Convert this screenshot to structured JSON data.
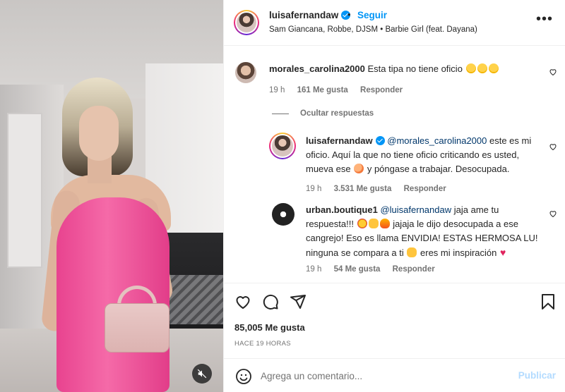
{
  "post": {
    "username": "luisafernandaw",
    "follow_label": "Seguir",
    "audio": "Sam Giancana, Robbe, DJSM • Barbie Girl (feat. Dayana)",
    "more_label": "•••"
  },
  "comments": [
    {
      "username": "morales_carolina2000",
      "text": "Esta tipa no tiene oficio",
      "emojis": [
        "laugh",
        "laugh",
        "laugh"
      ],
      "time": "19 h",
      "likes": "161 Me gusta",
      "reply_label": "Responder"
    }
  ],
  "hide_replies_label": "Ocultar respuestas",
  "replies": [
    {
      "username": "luisafernandaw",
      "mention": "@morales_carolina2000",
      "text_1": "este es mi oficio. Aquí la que no tiene oficio criticando es usted, mueva ese",
      "text_2": "y póngase a trabajar. Desocupada.",
      "time": "19 h",
      "likes": "3.531 Me gusta",
      "reply_label": "Responder"
    },
    {
      "username": "urban.boutique1",
      "mention": "@luisafernandaw",
      "text_1": "jaja ame tu respuesta!!!",
      "text_2": "jajaja le dijo desocupada a ese cangrejo! Eso es llama ENVIDIA! ESTAS HERMOSA LU! ninguna se compara a ti",
      "text_3": "eres mi inspiración",
      "time": "19 h",
      "likes": "54 Me gusta",
      "reply_label": "Responder"
    }
  ],
  "likes_count": "85,005 Me gusta",
  "time_ago": "HACE 19 HORAS",
  "comment_box": {
    "placeholder": "Agrega un comentario...",
    "publish_label": "Publicar"
  },
  "colors": {
    "accent": "#0095f6",
    "publish_disabled": "#b3dbff",
    "text": "#262626",
    "muted": "#737373",
    "dress": "#f0579b"
  }
}
